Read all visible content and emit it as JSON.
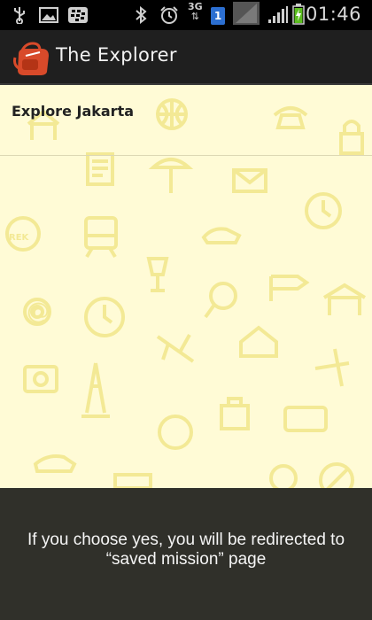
{
  "status_bar": {
    "time": "01:46",
    "network_type": "3G",
    "sim_slot": "1",
    "icons": [
      "usb-icon",
      "image-icon",
      "bbm-icon",
      "bluetooth-icon",
      "alarm-icon",
      "network-3g-icon",
      "sim-icon",
      "no-signal-icon",
      "signal-icon",
      "battery-charging-icon"
    ]
  },
  "app_bar": {
    "title": "The Explorer",
    "logo": "backpack-icon"
  },
  "list": {
    "items": [
      {
        "label": "Explore Jakarta"
      }
    ]
  },
  "dialog": {
    "message": "If you choose yes, you will be redirected to “saved mission” page"
  },
  "colors": {
    "status_bar_bg": "#000000",
    "app_bar_bg": "#1f1f1f",
    "content_bg": "#fffbd6",
    "doodle": "#f5ec9d",
    "dialog_bg": "#30302a",
    "logo_red": "#d84a2a"
  }
}
